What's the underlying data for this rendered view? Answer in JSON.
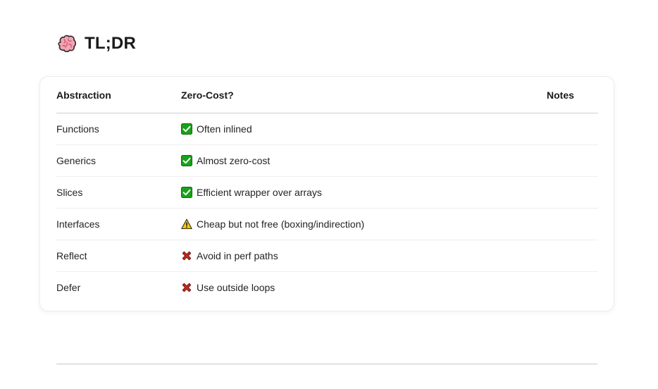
{
  "heading": {
    "icon": "brain-icon",
    "title": "TL;DR"
  },
  "table": {
    "headers": {
      "abstraction": "Abstraction",
      "zero_cost": "Zero-Cost?",
      "notes": "Notes"
    },
    "rows": [
      {
        "abstraction": "Functions",
        "status_icon": "check-icon",
        "zero_cost": "Often inlined",
        "notes": ""
      },
      {
        "abstraction": "Generics",
        "status_icon": "check-icon",
        "zero_cost": "Almost zero-cost",
        "notes": ""
      },
      {
        "abstraction": "Slices",
        "status_icon": "check-icon",
        "zero_cost": "Efficient wrapper over arrays",
        "notes": ""
      },
      {
        "abstraction": "Interfaces",
        "status_icon": "warning-icon",
        "zero_cost": "Cheap but not free (boxing/indirection)",
        "notes": ""
      },
      {
        "abstraction": "Reflect",
        "status_icon": "cross-icon",
        "zero_cost": "Avoid in perf paths",
        "notes": ""
      },
      {
        "abstraction": "Defer",
        "status_icon": "cross-icon",
        "zero_cost": "Use outside loops",
        "notes": ""
      }
    ]
  },
  "colors": {
    "check": "#1aa11a",
    "warning": "#f7c600",
    "cross": "#cc2b1d",
    "brain": "#f4a3b4"
  }
}
